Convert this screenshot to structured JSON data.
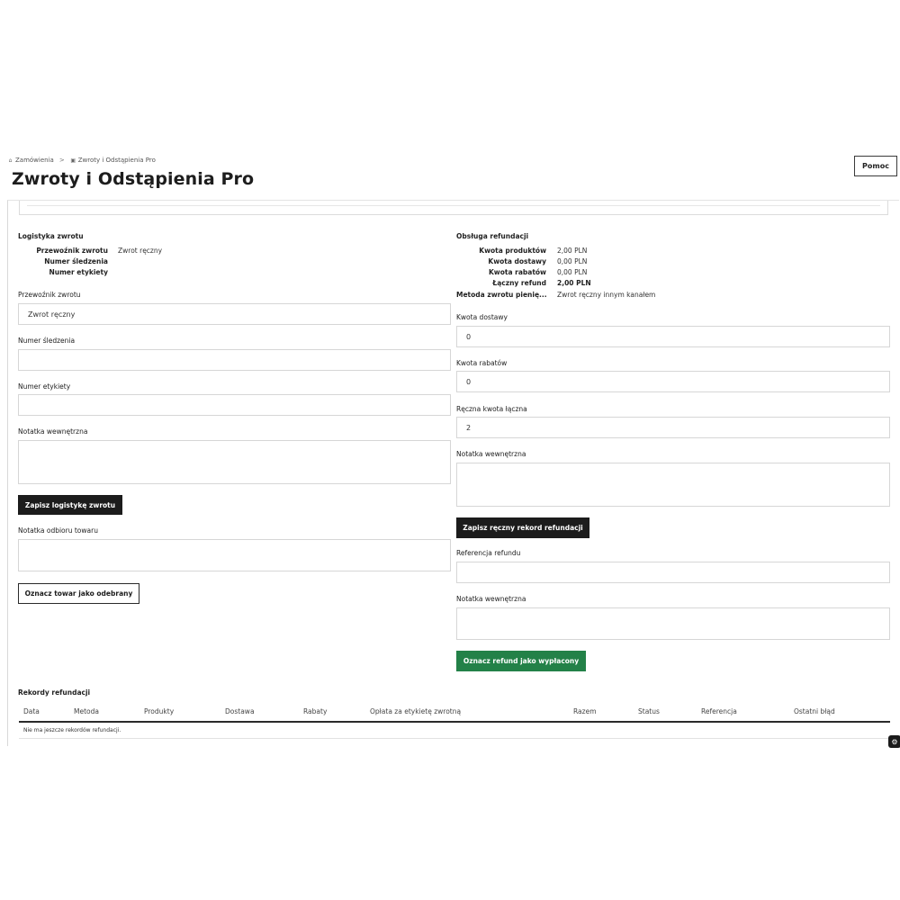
{
  "breadcrumb": {
    "parent": "Zamówienia",
    "separator": ">",
    "current": "Zwroty i Odstąpienia Pro",
    "parent_icon": "store-icon",
    "current_icon": "module-icon"
  },
  "page": {
    "title": "Zwroty i Odstąpienia Pro"
  },
  "header": {
    "help_label": "Pomoc"
  },
  "logistics": {
    "title": "Logistyka zwrotu",
    "summary": [
      {
        "label": "Przewoźnik zwrotu",
        "value": "Zwrot ręczny"
      },
      {
        "label": "Numer śledzenia",
        "value": ""
      },
      {
        "label": "Numer etykiety",
        "value": ""
      }
    ],
    "carrier_label": "Przewoźnik zwrotu",
    "carrier_value": "Zwrot ręczny",
    "tracking_label": "Numer śledzenia",
    "tracking_value": "",
    "label_number_label": "Numer etykiety",
    "label_number_value": "",
    "internal_note_label": "Notatka wewnętrzna",
    "save_label": "Zapisz logistykę zwrotu",
    "receipt_note_label": "Notatka odbioru towaru",
    "mark_received_label": "Oznacz towar jako odebrany"
  },
  "refund": {
    "title": "Obsługa refundacji",
    "summary": [
      {
        "label": "Kwota produktów",
        "value": "2,00 PLN"
      },
      {
        "label": "Kwota dostawy",
        "value": "0,00 PLN"
      },
      {
        "label": "Kwota rabatów",
        "value": "0,00 PLN"
      },
      {
        "label": "Łączny refund",
        "value": "2,00 PLN"
      }
    ],
    "method_label": "Metoda zwrotu pienię...",
    "method_value": "Zwrot ręczny innym kanałem",
    "shipping_label": "Kwota dostawy",
    "shipping_value": "0",
    "discount_label": "Kwota rabatów",
    "discount_value": "0",
    "manual_total_label": "Ręczna kwota łączna",
    "manual_total_value": "2",
    "internal_note_label": "Notatka wewnętrzna",
    "save_manual_label": "Zapisz ręczny rekord refundacji",
    "reference_label": "Referencja refundu",
    "reference_value": "",
    "internal_note2_label": "Notatka wewnętrzna",
    "mark_paid_label": "Oznacz refund jako wypłacony"
  },
  "records": {
    "title": "Rekordy refundacji",
    "columns": [
      "Data",
      "Metoda",
      "Produkty",
      "Dostawa",
      "Rabaty",
      "Opłata za etykietę zwrotną",
      "Razem",
      "Status",
      "Referencja",
      "Ostatni błąd"
    ],
    "empty_text": "Nie ma jeszcze rekordów refundacji."
  },
  "colors": {
    "primary_button": "#1c1c1c",
    "success_button": "#238148",
    "border": "#d6d6d6"
  }
}
